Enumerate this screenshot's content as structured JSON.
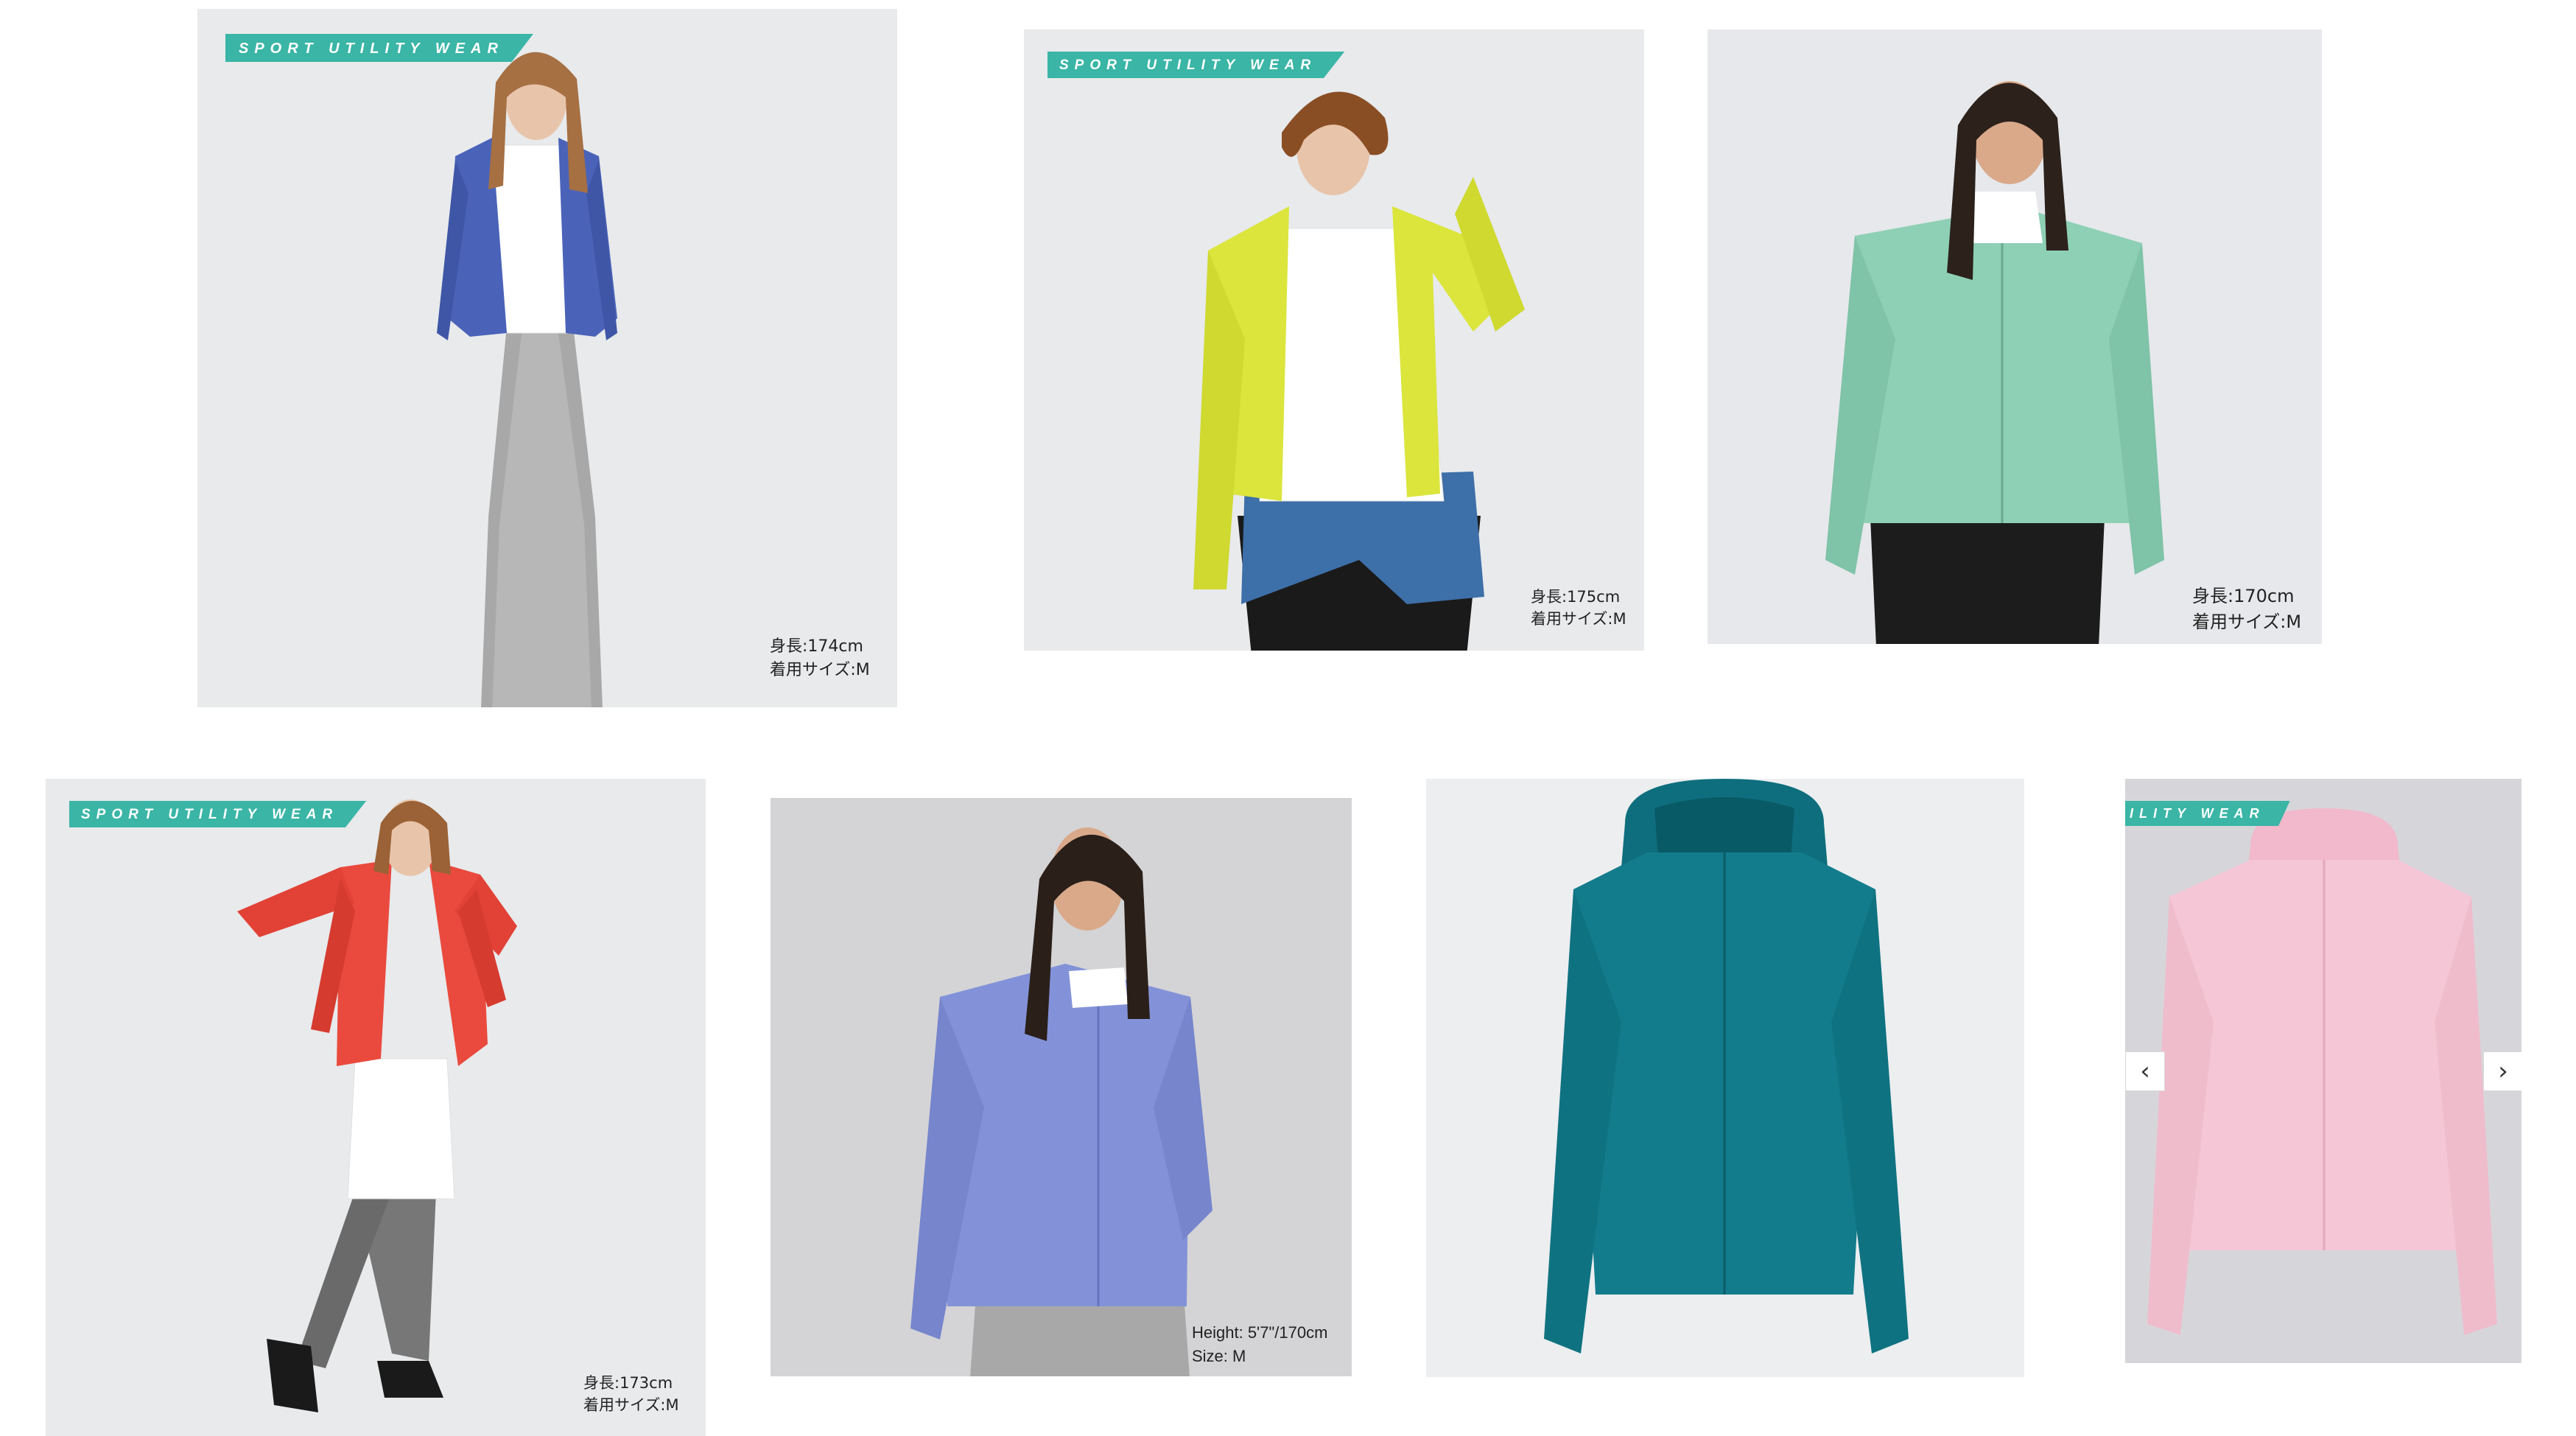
{
  "colors": {
    "badge": "#3ab5a6",
    "background": "#ffffff",
    "studio_backdrop": "#e8eaec"
  },
  "products": [
    {
      "name": "Blue zip hoodie on model",
      "jacket_color": "#4a63b8",
      "badge": "SPORT UTILITY WEAR",
      "caption_line1": "身長:174cm",
      "caption_line2": "着用サイズ:M"
    },
    {
      "name": "Lime zip hoodie on model",
      "jacket_color": "#dbe53c",
      "badge": "SPORT UTILITY WEAR",
      "caption_line1": "身長:175cm",
      "caption_line2": "着用サイズ:M"
    },
    {
      "name": "Mint zip hoodie on model",
      "jacket_color": "#8ed0b5",
      "caption_line1": "身長:170cm",
      "caption_line2": "着用サイズ:M"
    },
    {
      "name": "Red zip hoodie on model",
      "jacket_color": "#ea4a3e",
      "badge": "SPORT UTILITY WEAR",
      "caption_line1": "身長:173cm",
      "caption_line2": "着用サイズ:M"
    },
    {
      "name": "Periwinkle zip hoodie on model",
      "jacket_color": "#8392d8",
      "caption_line1": "Height: 5'7\"/170cm",
      "caption_line2": "Size: M"
    },
    {
      "name": "Teal zip hoodie flat lay",
      "jacket_color": "#137c8c"
    },
    {
      "name": "Pink zip hoodie flat lay",
      "jacket_color": "#f5c6d5",
      "badge": "ILITY WEAR"
    }
  ],
  "carousel": {
    "prev_icon": "‹",
    "next_icon": "›"
  }
}
